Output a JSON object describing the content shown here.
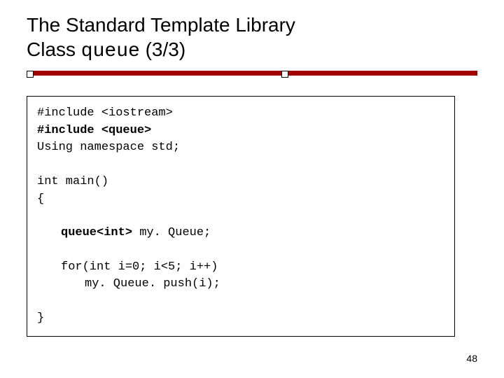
{
  "title": {
    "line1": "The Standard Template Library",
    "line2_prefix": "Class ",
    "line2_mono": "queue",
    "line2_suffix": " (3/3)"
  },
  "code": {
    "l1": "#include <iostream>",
    "l2": "#include <queue>",
    "l3": "Using namespace std;",
    "l4": "int main()",
    "l5": "{",
    "l6_bold": "queue<int>",
    "l6_rest": " my. Queue;",
    "l7": "for(int i=0; i<5; i++)",
    "l8": "my. Queue. push(i);",
    "l9": "}"
  },
  "page_number": "48"
}
